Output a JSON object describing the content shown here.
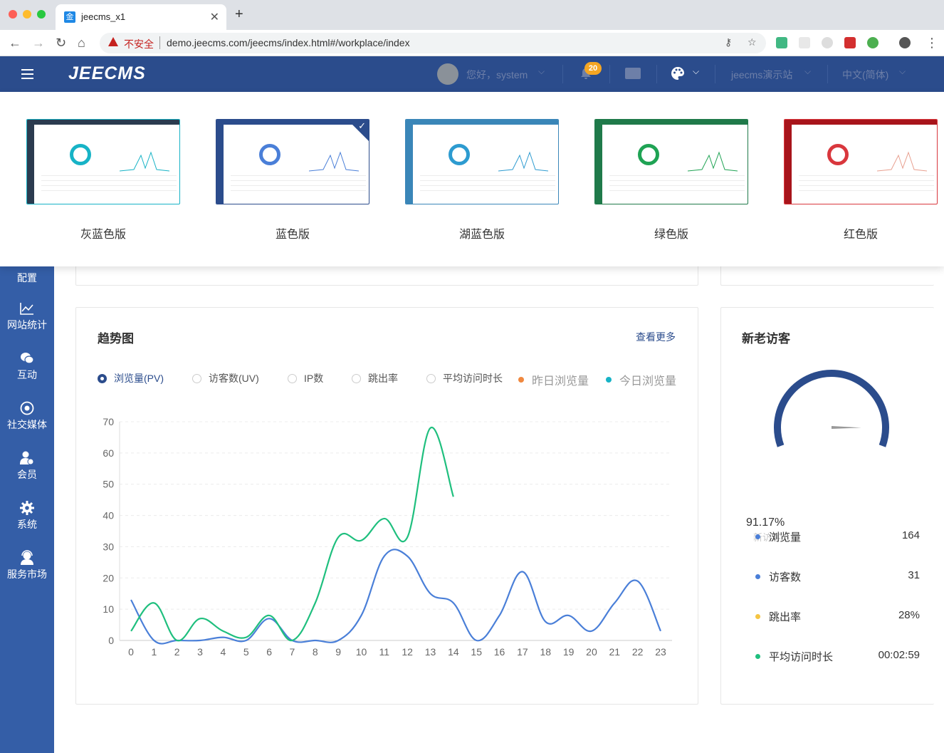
{
  "browser": {
    "tab_title": "jeecms_x1",
    "tab_favicon": "金",
    "security_label": "不安全",
    "url": "demo.jeecms.com/jeecms/index.html#/workplace/index"
  },
  "header": {
    "logo": "JEECMS",
    "greeting": "您好，system",
    "notification_count": "20",
    "site_name": "jeecms演示站",
    "language": "中文(简体)"
  },
  "sidebar": {
    "items": [
      {
        "label": "配置",
        "icon": "config-icon"
      },
      {
        "label": "网站统计",
        "icon": "chart-icon"
      },
      {
        "label": "互动",
        "icon": "chat-icon"
      },
      {
        "label": "社交媒体",
        "icon": "social-icon"
      },
      {
        "label": "会员",
        "icon": "member-icon"
      },
      {
        "label": "系统",
        "icon": "gear-icon"
      },
      {
        "label": "服务市场",
        "icon": "service-icon"
      }
    ]
  },
  "themes": [
    {
      "label": "灰蓝色版",
      "color": "#2b3b4f",
      "accent": "#17b3c6",
      "selected": false
    },
    {
      "label": "蓝色版",
      "color": "#2b4c8c",
      "accent": "#4a7fd8",
      "selected": true
    },
    {
      "label": "湖蓝色版",
      "color": "#3a86b8",
      "accent": "#2d9bd0",
      "selected": false
    },
    {
      "label": "绿色版",
      "color": "#1f7a4a",
      "accent": "#1fa354",
      "selected": false
    },
    {
      "label": "红色版",
      "color": "#a8141b",
      "accent": "#d9373d",
      "selected": false
    }
  ],
  "trend": {
    "title": "趋势图",
    "more_link": "查看更多",
    "options": [
      {
        "label": "浏览量(PV)",
        "selected": true
      },
      {
        "label": "访客数(UV)",
        "selected": false
      },
      {
        "label": "IP数",
        "selected": false
      },
      {
        "label": "跳出率",
        "selected": false
      },
      {
        "label": "平均访问时长",
        "selected": false
      }
    ],
    "series_legend": [
      {
        "label": "昨日浏览量",
        "color": "#f0883f"
      },
      {
        "label": "今日浏览量",
        "color": "#17b3c6"
      }
    ]
  },
  "chart_data": {
    "type": "line",
    "x": [
      0,
      1,
      2,
      3,
      4,
      5,
      6,
      7,
      8,
      9,
      10,
      11,
      12,
      13,
      14,
      15,
      16,
      17,
      18,
      19,
      20,
      21,
      22,
      23
    ],
    "ylim": [
      0,
      70
    ],
    "yticks": [
      0,
      10,
      20,
      30,
      40,
      50,
      60,
      70
    ],
    "grid": true,
    "series": [
      {
        "color": "#4a7fd8",
        "values": [
          13,
          0,
          0,
          0,
          1,
          0,
          7,
          0,
          0,
          0,
          8,
          27,
          27,
          15,
          12,
          0,
          8,
          22,
          6,
          8,
          3,
          12,
          19,
          3
        ]
      },
      {
        "color": "#1fbf7e",
        "values": [
          3,
          12,
          0,
          7,
          3,
          1,
          8,
          0,
          12,
          33,
          32,
          39,
          33,
          68,
          46
        ]
      }
    ]
  },
  "visitors": {
    "title": "新老访客",
    "gauge_percent": "91.17%",
    "gauge_value": 0.9117,
    "gauge_overlay_text": "新访客",
    "rows": [
      {
        "label": "浏览量",
        "value": "164",
        "color": "#4a7fd8"
      },
      {
        "label": "访客数",
        "value": "31",
        "color": "#4a7fd8"
      },
      {
        "label": "跳出率",
        "value": "28%",
        "color": "#f5c542"
      },
      {
        "label": "平均访问时长",
        "value": "00:02:59",
        "color": "#1fbf7e"
      }
    ]
  }
}
